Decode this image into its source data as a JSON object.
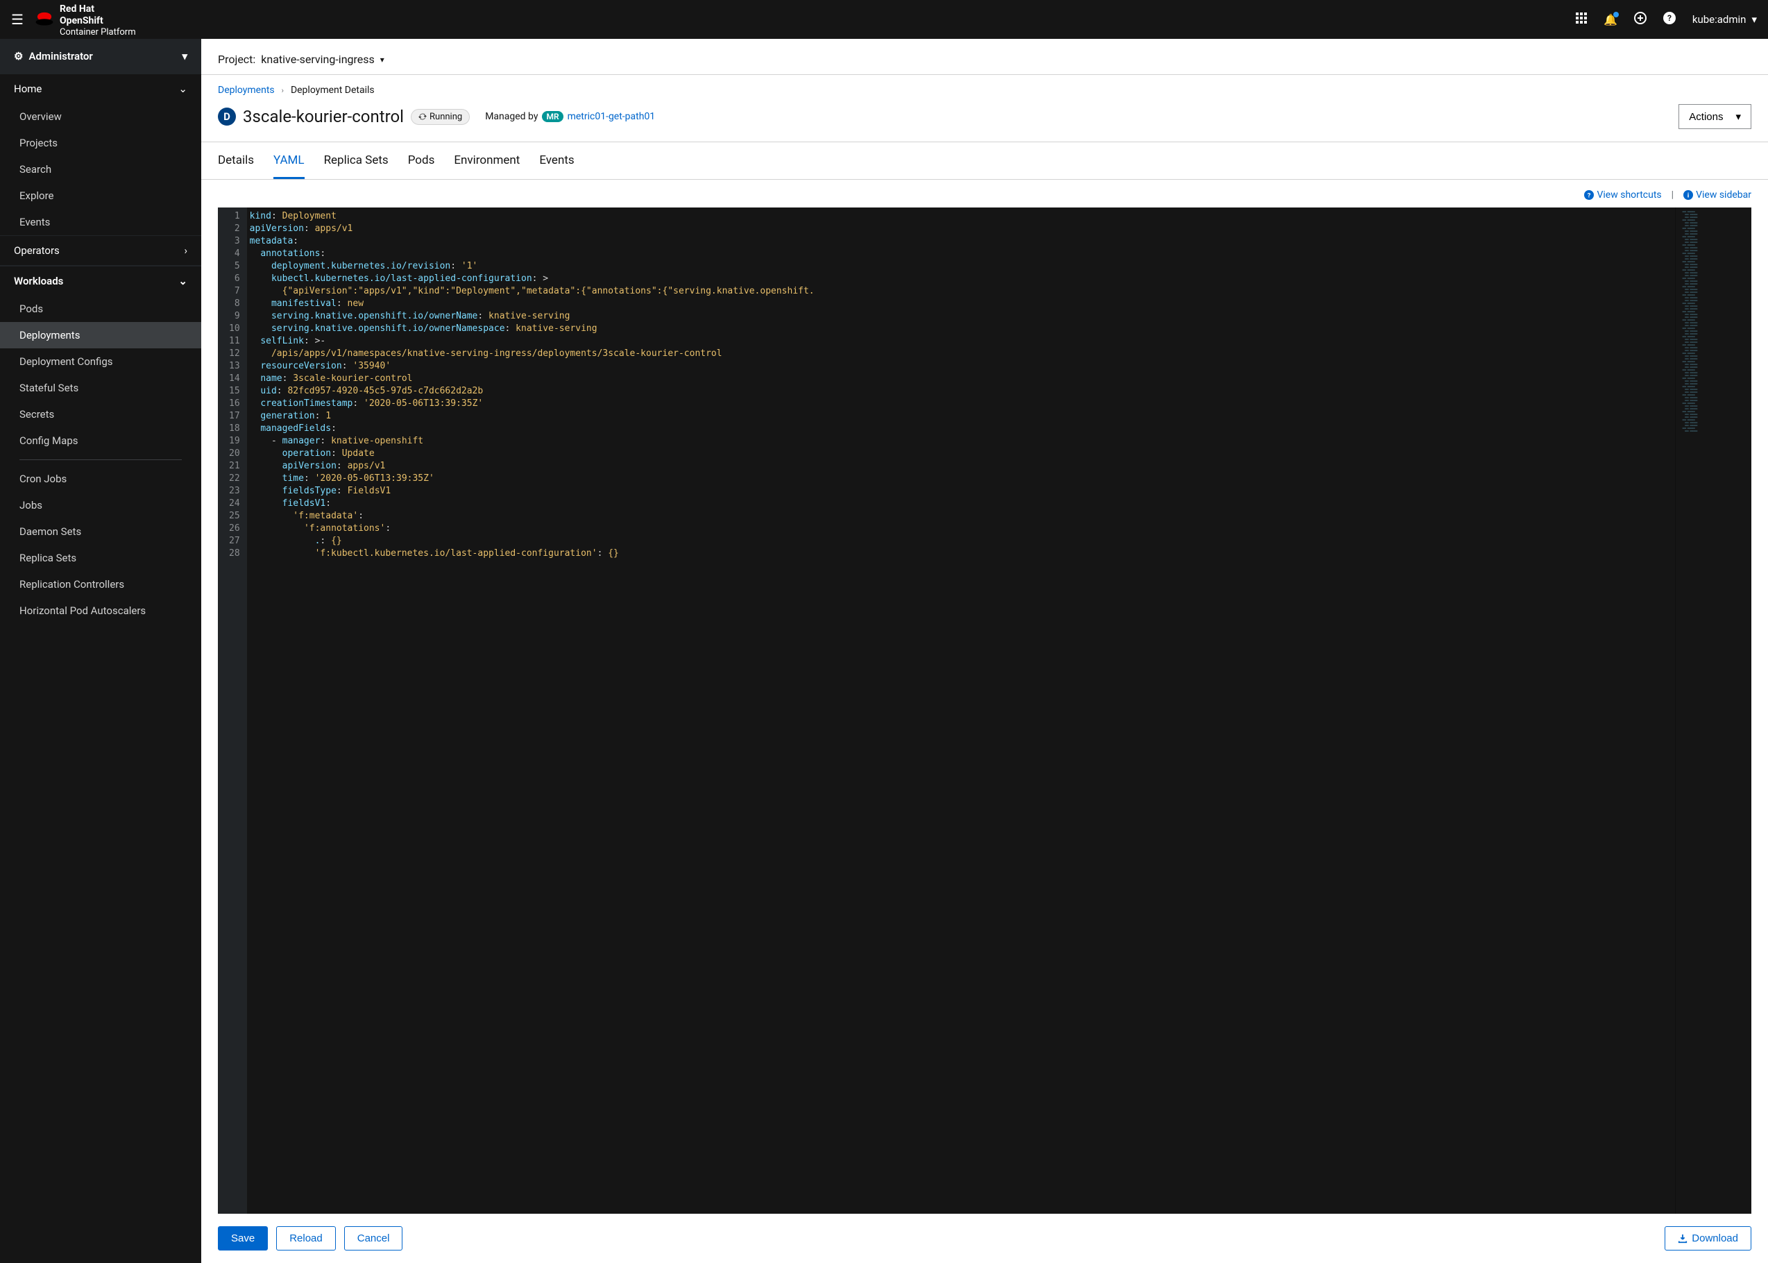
{
  "brand": {
    "line1": "Red Hat",
    "line2": "OpenShift",
    "line3": "Container Platform"
  },
  "user": "kube:admin",
  "navAdmin": "Administrator",
  "navHome": {
    "label": "Home",
    "items": [
      "Overview",
      "Projects",
      "Search",
      "Explore",
      "Events"
    ]
  },
  "navOperators": "Operators",
  "navWorkloads": {
    "label": "Workloads",
    "items": [
      "Pods",
      "Deployments",
      "Deployment Configs",
      "Stateful Sets",
      "Secrets",
      "Config Maps"
    ],
    "items2": [
      "Cron Jobs",
      "Jobs",
      "Daemon Sets",
      "Replica Sets",
      "Replication Controllers",
      "Horizontal Pod Autoscalers"
    ]
  },
  "projectLabel": "Project:",
  "projectName": "knative-serving-ingress",
  "bc": {
    "deployments": "Deployments",
    "details": "Deployment Details"
  },
  "title": "3scale-kourier-control",
  "resLetter": "D",
  "status": "Running",
  "managedBy": "Managed by",
  "mrBadge": "MR",
  "mrLink": "metric01-get-path01",
  "actions": "Actions",
  "tabs": [
    "Details",
    "YAML",
    "Replica Sets",
    "Pods",
    "Environment",
    "Events"
  ],
  "shortcuts": "View shortcuts",
  "sidebarLink": "View sidebar",
  "buttons": {
    "save": "Save",
    "reload": "Reload",
    "cancel": "Cancel",
    "download": "Download"
  },
  "yaml": [
    [
      [
        "key",
        "kind"
      ],
      [
        "punc",
        ": "
      ],
      [
        "str",
        "Deployment"
      ]
    ],
    [
      [
        "key",
        "apiVersion"
      ],
      [
        "punc",
        ": "
      ],
      [
        "str",
        "apps/v1"
      ]
    ],
    [
      [
        "key",
        "metadata"
      ],
      [
        "punc",
        ":"
      ]
    ],
    [
      [
        "plain",
        "  "
      ],
      [
        "key",
        "annotations"
      ],
      [
        "punc",
        ":"
      ]
    ],
    [
      [
        "plain",
        "    "
      ],
      [
        "key",
        "deployment.kubernetes.io/revision"
      ],
      [
        "punc",
        ": "
      ],
      [
        "str",
        "'1'"
      ]
    ],
    [
      [
        "plain",
        "    "
      ],
      [
        "key",
        "kubectl.kubernetes.io/last-applied-configuration"
      ],
      [
        "punc",
        ": >"
      ]
    ],
    [
      [
        "plain",
        "      "
      ],
      [
        "str",
        "{\"apiVersion\":\"apps/v1\",\"kind\":\"Deployment\",\"metadata\":{\"annotations\":{\"serving.knative.openshift."
      ]
    ],
    [
      [
        "plain",
        "    "
      ],
      [
        "key",
        "manifestival"
      ],
      [
        "punc",
        ": "
      ],
      [
        "str",
        "new"
      ]
    ],
    [
      [
        "plain",
        "    "
      ],
      [
        "key",
        "serving.knative.openshift.io/ownerName"
      ],
      [
        "punc",
        ": "
      ],
      [
        "str",
        "knative-serving"
      ]
    ],
    [
      [
        "plain",
        "    "
      ],
      [
        "key",
        "serving.knative.openshift.io/ownerNamespace"
      ],
      [
        "punc",
        ": "
      ],
      [
        "str",
        "knative-serving"
      ]
    ],
    [
      [
        "plain",
        "  "
      ],
      [
        "key",
        "selfLink"
      ],
      [
        "punc",
        ": >-"
      ]
    ],
    [
      [
        "plain",
        "    "
      ],
      [
        "str",
        "/apis/apps/v1/namespaces/knative-serving-ingress/deployments/3scale-kourier-control"
      ]
    ],
    [
      [
        "plain",
        "  "
      ],
      [
        "key",
        "resourceVersion"
      ],
      [
        "punc",
        ": "
      ],
      [
        "str",
        "'35940'"
      ]
    ],
    [
      [
        "plain",
        "  "
      ],
      [
        "key",
        "name"
      ],
      [
        "punc",
        ": "
      ],
      [
        "str",
        "3scale-kourier-control"
      ]
    ],
    [
      [
        "plain",
        "  "
      ],
      [
        "key",
        "uid"
      ],
      [
        "punc",
        ": "
      ],
      [
        "str",
        "82fcd957-4920-45c5-97d5-c7dc662d2a2b"
      ]
    ],
    [
      [
        "plain",
        "  "
      ],
      [
        "key",
        "creationTimestamp"
      ],
      [
        "punc",
        ": "
      ],
      [
        "str",
        "'2020-05-06T13:39:35Z'"
      ]
    ],
    [
      [
        "plain",
        "  "
      ],
      [
        "key",
        "generation"
      ],
      [
        "punc",
        ": "
      ],
      [
        "str",
        "1"
      ]
    ],
    [
      [
        "plain",
        "  "
      ],
      [
        "key",
        "managedFields"
      ],
      [
        "punc",
        ":"
      ]
    ],
    [
      [
        "plain",
        "    - "
      ],
      [
        "key",
        "manager"
      ],
      [
        "punc",
        ": "
      ],
      [
        "str",
        "knative-openshift"
      ]
    ],
    [
      [
        "plain",
        "      "
      ],
      [
        "key",
        "operation"
      ],
      [
        "punc",
        ": "
      ],
      [
        "str",
        "Update"
      ]
    ],
    [
      [
        "plain",
        "      "
      ],
      [
        "key",
        "apiVersion"
      ],
      [
        "punc",
        ": "
      ],
      [
        "str",
        "apps/v1"
      ]
    ],
    [
      [
        "plain",
        "      "
      ],
      [
        "key",
        "time"
      ],
      [
        "punc",
        ": "
      ],
      [
        "str",
        "'2020-05-06T13:39:35Z'"
      ]
    ],
    [
      [
        "plain",
        "      "
      ],
      [
        "key",
        "fieldsType"
      ],
      [
        "punc",
        ": "
      ],
      [
        "str",
        "FieldsV1"
      ]
    ],
    [
      [
        "plain",
        "      "
      ],
      [
        "key",
        "fieldsV1"
      ],
      [
        "punc",
        ":"
      ]
    ],
    [
      [
        "plain",
        "        "
      ],
      [
        "str",
        "'f:metadata'"
      ],
      [
        "punc",
        ":"
      ]
    ],
    [
      [
        "plain",
        "          "
      ],
      [
        "str",
        "'f:annotations'"
      ],
      [
        "punc",
        ":"
      ]
    ],
    [
      [
        "plain",
        "            "
      ],
      [
        "key",
        "."
      ],
      [
        "punc",
        ": "
      ],
      [
        "str",
        "{}"
      ]
    ],
    [
      [
        "plain",
        "            "
      ],
      [
        "str",
        "'f:kubectl.kubernetes.io/last-applied-configuration'"
      ],
      [
        "punc",
        ": "
      ],
      [
        "str",
        "{}"
      ]
    ]
  ]
}
